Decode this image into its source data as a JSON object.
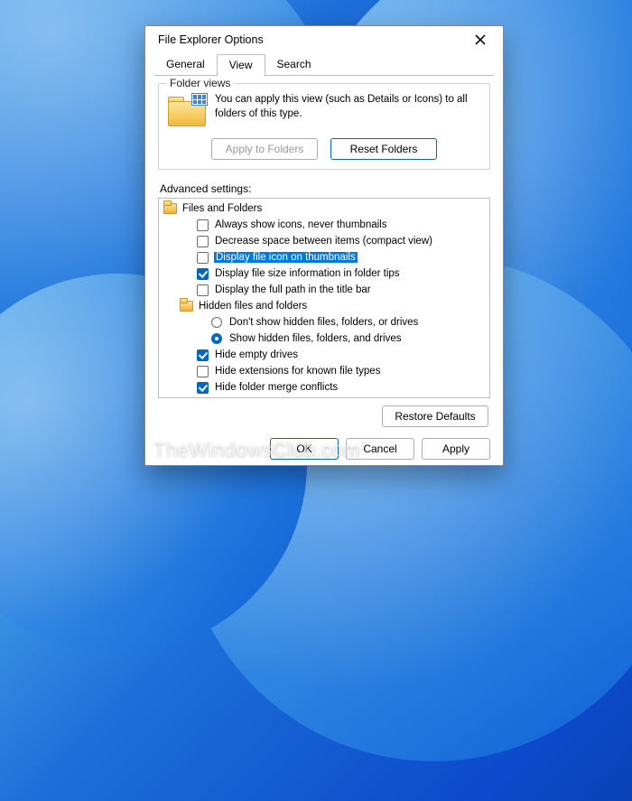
{
  "dialog": {
    "title": "File Explorer Options"
  },
  "tabs": {
    "general": "General",
    "view": "View",
    "search": "Search",
    "active": "view"
  },
  "folder_views": {
    "legend": "Folder views",
    "desc": "You can apply this view (such as Details or Icons) to all folders of this type.",
    "apply": "Apply to Folders",
    "reset": "Reset Folders"
  },
  "advanced": {
    "label": "Advanced settings:",
    "root": "Files and Folders",
    "items": [
      {
        "type": "check",
        "label": "Always show icons, never thumbnails",
        "checked": false
      },
      {
        "type": "check",
        "label": "Decrease space between items (compact view)",
        "checked": false
      },
      {
        "type": "check",
        "label": "Display file icon on thumbnails",
        "checked": false,
        "selected": true
      },
      {
        "type": "check",
        "label": "Display file size information in folder tips",
        "checked": true
      },
      {
        "type": "check",
        "label": "Display the full path in the title bar",
        "checked": false
      },
      {
        "type": "folder",
        "label": "Hidden files and folders"
      },
      {
        "type": "radio",
        "label": "Don't show hidden files, folders, or drives",
        "on": false,
        "indent": 3
      },
      {
        "type": "radio",
        "label": "Show hidden files, folders, and drives",
        "on": true,
        "indent": 3
      },
      {
        "type": "check",
        "label": "Hide empty drives",
        "checked": true
      },
      {
        "type": "check",
        "label": "Hide extensions for known file types",
        "checked": false
      },
      {
        "type": "check",
        "label": "Hide folder merge conflicts",
        "checked": true
      }
    ],
    "restore": "Restore Defaults"
  },
  "actions": {
    "ok": "OK",
    "cancel": "Cancel",
    "apply": "Apply"
  },
  "watermark": "TheWindowsClub.com"
}
